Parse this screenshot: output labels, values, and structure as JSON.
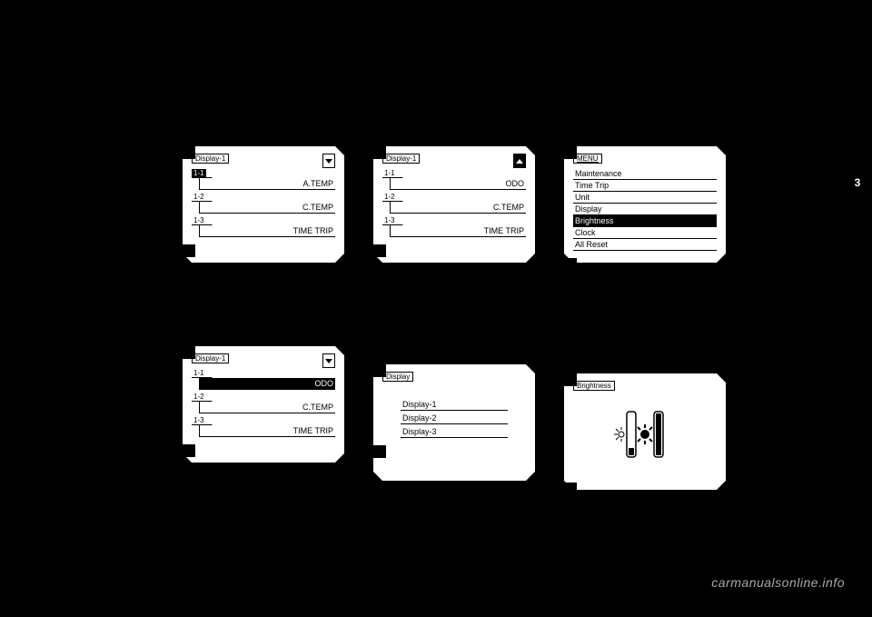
{
  "page_tab": "3",
  "watermark": "carmanualsonline.info",
  "screens": {
    "s1": {
      "title": "Display-1",
      "scroll": "down",
      "rows": [
        {
          "tag": "1-1",
          "tag_sel": true,
          "val": "A.TEMP",
          "val_sel": false
        },
        {
          "tag": "1-2",
          "tag_sel": false,
          "val": "C.TEMP",
          "val_sel": false
        },
        {
          "tag": "1-3",
          "tag_sel": false,
          "val": "TIME TRIP",
          "val_sel": false
        }
      ]
    },
    "s2": {
      "title": "Display-1",
      "scroll": "up-filled",
      "rows": [
        {
          "tag": "1-1",
          "tag_sel": false,
          "val": "ODO",
          "val_sel": false
        },
        {
          "tag": "1-2",
          "tag_sel": false,
          "val": "C.TEMP",
          "val_sel": false
        },
        {
          "tag": "1-3",
          "tag_sel": false,
          "val": "TIME TRIP",
          "val_sel": false
        }
      ]
    },
    "s3": {
      "title": "MENU",
      "items": [
        {
          "label": "Maintenance",
          "sel": false
        },
        {
          "label": "Time Trip",
          "sel": false
        },
        {
          "label": "Unit",
          "sel": false
        },
        {
          "label": "Display",
          "sel": false
        },
        {
          "label": "Brightness",
          "sel": true
        },
        {
          "label": "Clock",
          "sel": false
        },
        {
          "label": "All Reset",
          "sel": false
        }
      ]
    },
    "s4": {
      "title": "Display-1",
      "scroll": "down",
      "rows": [
        {
          "tag": "1-1",
          "tag_sel": false,
          "val": "ODO",
          "val_sel": true
        },
        {
          "tag": "1-2",
          "tag_sel": false,
          "val": "C.TEMP",
          "val_sel": false
        },
        {
          "tag": "1-3",
          "tag_sel": false,
          "val": "TIME TRIP",
          "val_sel": false
        }
      ]
    },
    "s5": {
      "title": "Display",
      "items": [
        {
          "label": "Display-1",
          "sel": false
        },
        {
          "label": "Display-2",
          "sel": false
        },
        {
          "label": "Display-3",
          "sel": false
        }
      ]
    },
    "s6": {
      "title": "Brightness"
    }
  }
}
